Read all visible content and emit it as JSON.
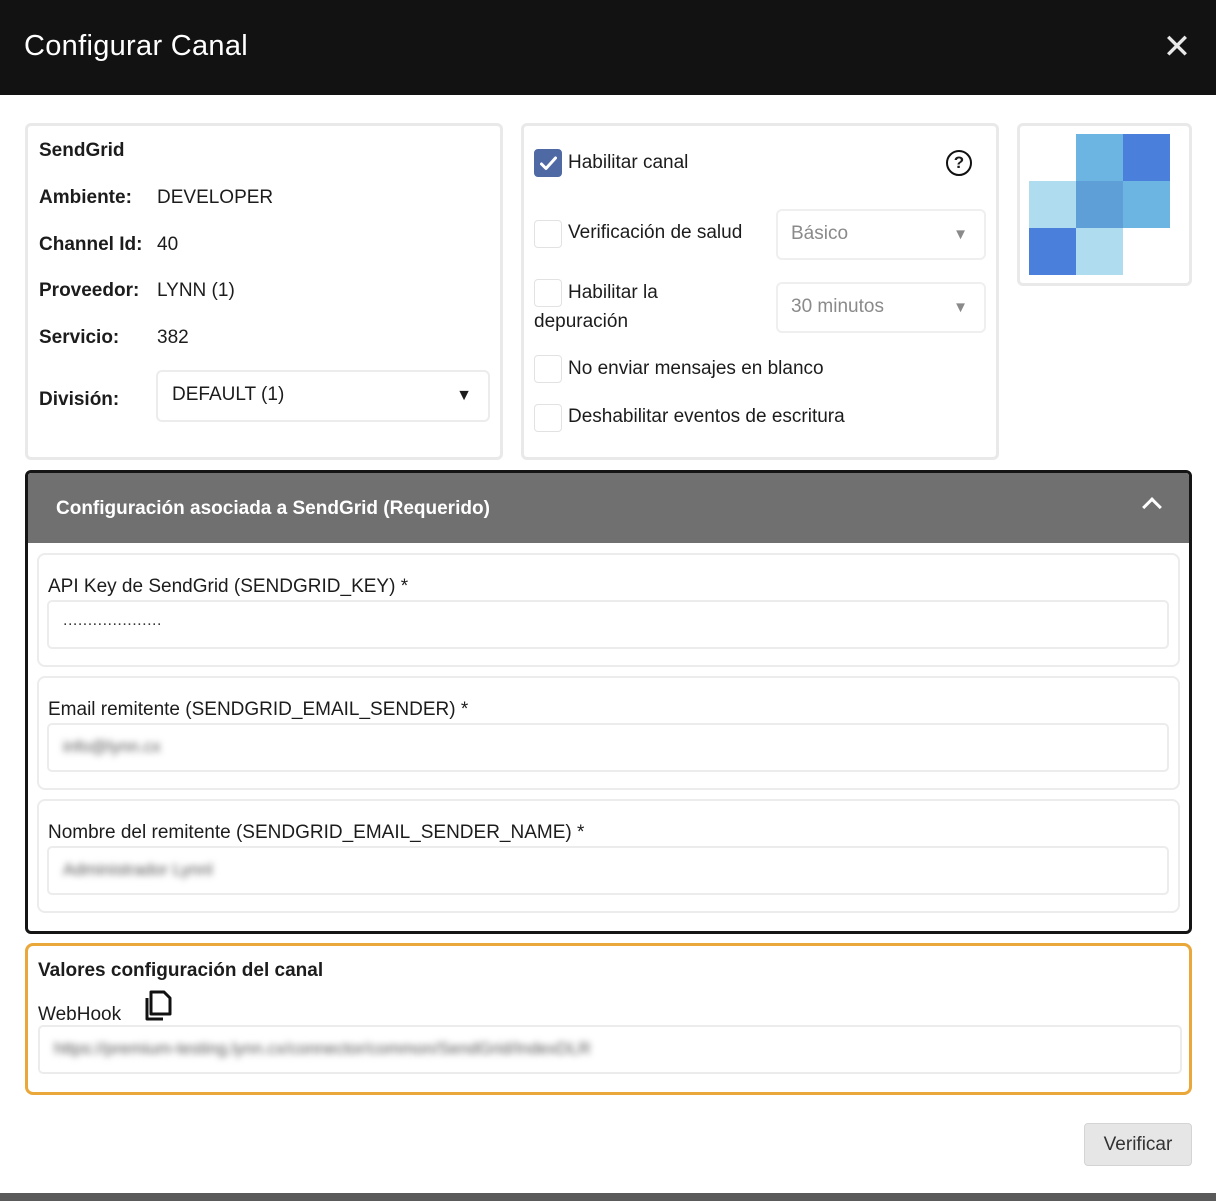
{
  "modal": {
    "title": "Configurar Canal",
    "close_symbol": "✕"
  },
  "info": {
    "brand": "SendGrid",
    "rows": [
      {
        "label": "Ambiente:",
        "value": "DEVELOPER"
      },
      {
        "label": "Channel Id:",
        "value": "40"
      },
      {
        "label": "Proveedor:",
        "value": "LYNN (1)"
      },
      {
        "label": "Servicio:",
        "value": "382"
      }
    ],
    "division": {
      "label": "División:",
      "selected": "DEFAULT (1)",
      "arrow": "▼"
    }
  },
  "options": {
    "enable_channel": {
      "label": "Habilitar canal",
      "checked": true
    },
    "help_symbol": "?",
    "health_check": {
      "label": "Verificación de salud",
      "checked": false,
      "select_value": "Básico"
    },
    "debug": {
      "label_line1": "Habilitar la",
      "label_line2": "depuración",
      "checked": false,
      "select_value": "30 minutos"
    },
    "no_blank": {
      "label": "No enviar mensajes en blanco",
      "checked": false
    },
    "disable_write_events": {
      "label": "Deshabilitar eventos de escritura",
      "checked": false
    },
    "select_arrow": "▼"
  },
  "logo": {
    "colors": {
      "dark": "#4a7fdc",
      "mid": "#5f9fd8",
      "light": "#6cb4e2",
      "pale": "#b0dcef"
    }
  },
  "required_section": {
    "title": "Configuración asociada a SendGrid (Requerido)",
    "fields": [
      {
        "label": "API Key de SendGrid (SENDGRID_KEY) *",
        "value": "...................."
      },
      {
        "label": "Email remitente (SENDGRID_EMAIL_SENDER) *",
        "value": "info@lynn.cx"
      },
      {
        "label": "Nombre del remitente (SENDGRID_EMAIL_SENDER_NAME) *",
        "value": "Administrador Lynnl"
      }
    ]
  },
  "channel_values": {
    "title": "Valores configuración del canal",
    "webhook_label": "WebHook",
    "webhook_value": "https://premium-testing.lynn.cx/connector/common/SendGrid/IndexDLR"
  },
  "actions": {
    "verify_label": "Verificar"
  },
  "colors": {
    "header_bg": "#121212",
    "section_header_bg": "#707070",
    "checkbox_checked": "#4f69a5",
    "values_border": "#eaa73a"
  }
}
